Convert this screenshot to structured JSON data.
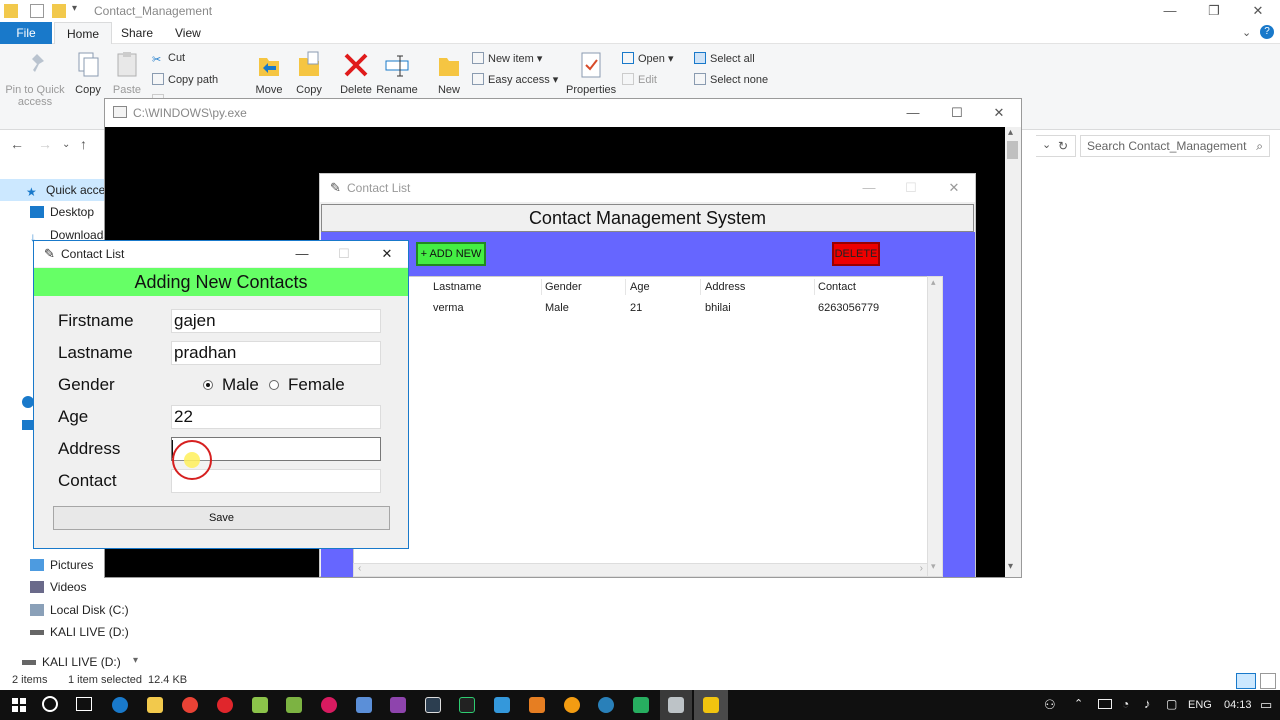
{
  "explorer": {
    "title": "Contact_Management",
    "tabs": {
      "file": "File",
      "home": "Home",
      "share": "Share",
      "view": "View"
    },
    "ribbon": {
      "pin_label": "Pin to Quick access",
      "copy_label": "Copy",
      "paste_label": "Paste",
      "cut_label": "Cut",
      "copy_path_label": "Copy path",
      "move_label": "Move",
      "copy_to_label": "Copy",
      "delete_label": "Delete",
      "rename_label": "Rename",
      "new_label": "New",
      "new_item_label": "New item",
      "easy_access_label": "Easy access",
      "properties_label": "Properties",
      "open_label": "Open",
      "edit_label": "Edit",
      "select_all_label": "Select all",
      "select_none_label": "Select none"
    },
    "search_placeholder": "Search Contact_Management",
    "nav": {
      "quick_access": "Quick access",
      "desktop": "Desktop",
      "downloads": "Downloads",
      "pictures": "Pictures",
      "videos": "Videos",
      "local_disk": "Local Disk (C:)",
      "kali1": "KALI LIVE (D:)",
      "kali2": "KALI LIVE (D:)"
    },
    "status": {
      "items": "2 items",
      "selected": "1 item selected",
      "size": "12.4 KB"
    }
  },
  "console": {
    "title": "C:\\WINDOWS\\py.exe"
  },
  "main_window": {
    "title": "Contact List",
    "header": "Contact Management System",
    "add_button": "+ ADD NEW",
    "delete_button": "DELETE",
    "columns": [
      "Lastname",
      "Gender",
      "Age",
      "Address",
      "Contact"
    ],
    "rows": [
      {
        "lastname": "verma",
        "gender": "Male",
        "age": "21",
        "address": "bhilai",
        "contact": "6263056779"
      }
    ]
  },
  "dialog": {
    "title": "Contact List",
    "banner": "Adding New Contacts",
    "labels": {
      "firstname": "Firstname",
      "lastname": "Lastname",
      "gender": "Gender",
      "age": "Age",
      "address": "Address",
      "contact": "Contact"
    },
    "values": {
      "firstname": "gajen",
      "lastname": "pradhan",
      "age": "22",
      "address": "",
      "contact": ""
    },
    "gender_options": {
      "male": "Male",
      "female": "Female"
    },
    "selected_gender": "Male",
    "save_button": "Save"
  },
  "taskbar": {
    "lang": "ENG",
    "time": "04:13"
  }
}
